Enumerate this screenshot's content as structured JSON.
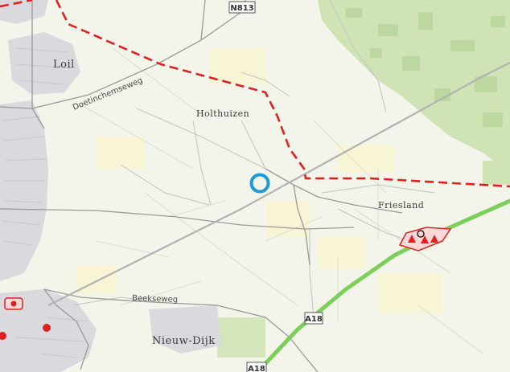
{
  "map": {
    "places": {
      "loil": "Loil",
      "holthuizen": "Holthuizen",
      "friesland": "Friesland",
      "nieuw_dijk": "Nieuw-Dijk"
    },
    "streets": {
      "doetinchemseweg": "Doetinchemseweg",
      "beekseweg": "Beekseweg"
    },
    "road_shields": {
      "n813": "N813",
      "a18_upper": "A18",
      "a18_lower": "A18"
    },
    "marker": {
      "color": "#1e9bd7",
      "icon": "location-ring-icon"
    },
    "colors": {
      "background": "#f3f4ea",
      "urban": "#d9d9de",
      "forest": "#cfe3b5",
      "highway": "#7ccf5a",
      "boundary": "#e0201f",
      "railway": "#b3b3b3",
      "road": "#a3a3a3",
      "hazard": "#e0201f"
    }
  }
}
